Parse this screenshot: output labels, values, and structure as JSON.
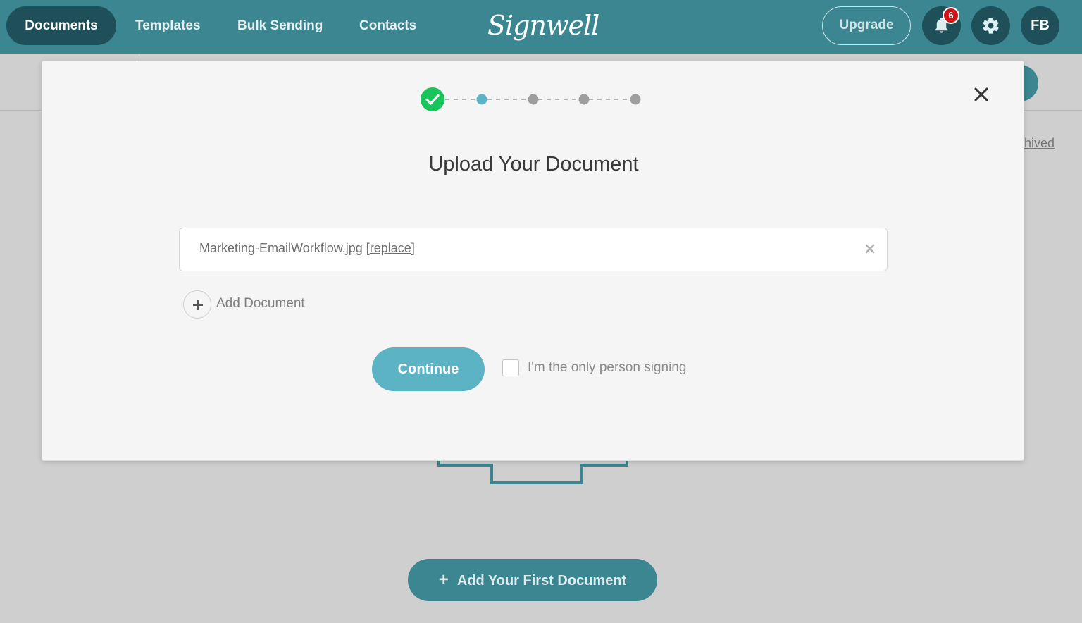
{
  "nav": {
    "items": [
      {
        "label": "Documents",
        "active": true
      },
      {
        "label": "Templates",
        "active": false
      },
      {
        "label": "Bulk Sending",
        "active": false
      },
      {
        "label": "Contacts",
        "active": false
      }
    ],
    "logo_text": "Signwell",
    "upgrade_label": "Upgrade",
    "notification_count": "6",
    "avatar_initials": "FB"
  },
  "background": {
    "archived_link_partial": "hived",
    "add_first_document_label": "Add Your First Document",
    "add_icon": "plus-icon"
  },
  "modal": {
    "title": "Upload Your Document",
    "stepper": {
      "total_steps": 5,
      "completed_steps": 1,
      "current_step": 2
    },
    "file": {
      "name": "Marketing-EmailWorkflow.jpg",
      "replace_label": "replace"
    },
    "add_document_label": "Add Document",
    "continue_label": "Continue",
    "only_signer_label": "I'm the only person signing",
    "only_signer_checked": false
  },
  "colors": {
    "nav_bg": "#3b8690",
    "nav_active_bg": "#1f4f58",
    "accent_button": "#5bb3c4",
    "step_complete": "#19c45a",
    "step_current": "#5bb3c4",
    "step_pending": "#9e9e9e",
    "badge": "#cc1717"
  }
}
